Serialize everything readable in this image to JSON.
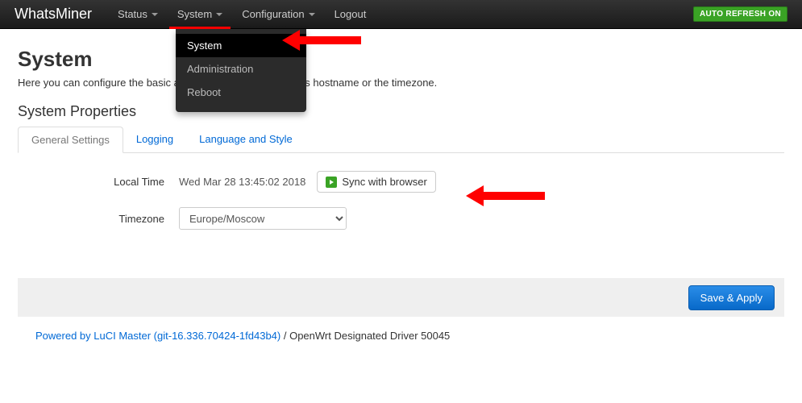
{
  "brand": "WhatsMiner",
  "nav": {
    "status": "Status",
    "system": "System",
    "configuration": "Configuration",
    "logout": "Logout"
  },
  "auto_refresh": "AUTO REFRESH ON",
  "dropdown": {
    "system": "System",
    "administration": "Administration",
    "reboot": "Reboot"
  },
  "page": {
    "title": "System",
    "desc": "Here you can configure the basic aspects of your device like its hostname or the timezone."
  },
  "section_title": "System Properties",
  "tabs": {
    "general": "General Settings",
    "logging": "Logging",
    "lang": "Language and Style"
  },
  "form": {
    "local_time_label": "Local Time",
    "local_time_value": "Wed Mar 28 13:45:02 2018",
    "sync_btn": "Sync with browser",
    "timezone_label": "Timezone",
    "timezone_value": "Europe/Moscow"
  },
  "save_apply": "Save & Apply",
  "footer": {
    "link": "Powered by LuCI Master (git-16.336.70424-1fd43b4)",
    "rest": " / OpenWrt Designated Driver 50045"
  }
}
